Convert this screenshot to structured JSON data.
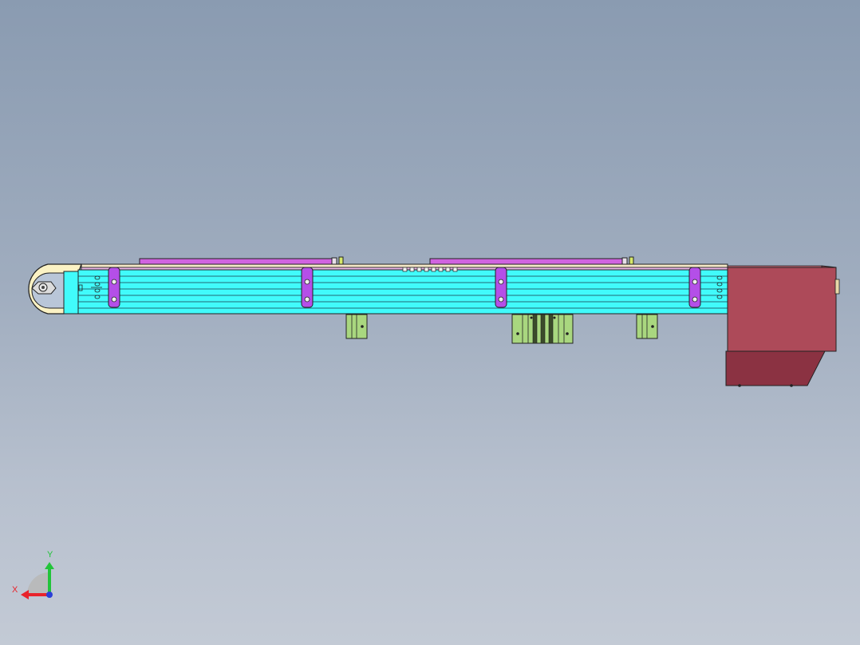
{
  "viewport": {
    "background_top": "#8a9bb1",
    "background_bottom": "#c3cad5"
  },
  "model": {
    "belt_color": "#41fbfb",
    "bracket_color": "#b44fe8",
    "top_rail_color": "#d063e0",
    "support_color": "#a9d77f",
    "motor_color_front": "#ad4a59",
    "motor_color_side": "#8b3242",
    "end_roller_color": "#fbf2c4"
  },
  "triad": {
    "x_label": "X",
    "y_label": "Y",
    "x_color": "#e8232b",
    "y_color": "#22c43a",
    "z_color": "#2a3fd8"
  }
}
